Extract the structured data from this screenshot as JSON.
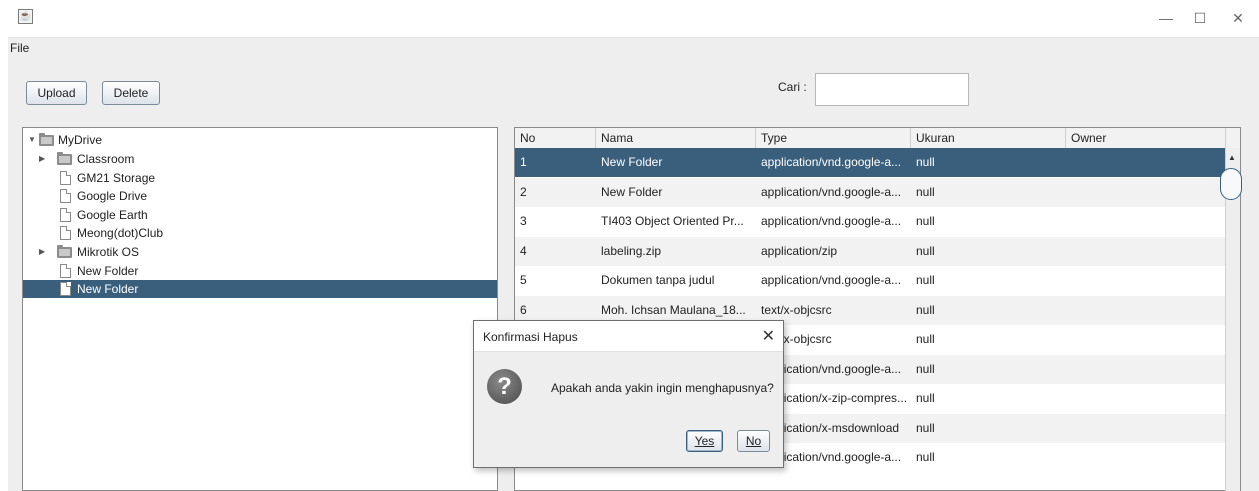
{
  "window": {
    "icon": "java-cup-icon",
    "controls": {
      "minimize": "—",
      "maximize": "☐",
      "close": "✕"
    }
  },
  "menu": {
    "file": "File"
  },
  "toolbar": {
    "upload": "Upload",
    "delete": "Delete",
    "search_label": "Cari :",
    "search_value": ""
  },
  "tree": {
    "root": "MyDrive",
    "items": [
      {
        "label": "Classroom",
        "kind": "folder"
      },
      {
        "label": "GM21 Storage",
        "kind": "file"
      },
      {
        "label": "Google Drive",
        "kind": "file"
      },
      {
        "label": "Google Earth",
        "kind": "file"
      },
      {
        "label": "Meong(dot)Club",
        "kind": "file"
      },
      {
        "label": "Mikrotik OS",
        "kind": "folder"
      },
      {
        "label": "New Folder",
        "kind": "file"
      },
      {
        "label": "New Folder",
        "kind": "file",
        "selected": true
      }
    ]
  },
  "table": {
    "columns": [
      "No",
      "Nama",
      "Type",
      "Ukuran",
      "Owner"
    ],
    "rows": [
      {
        "no": "1",
        "nama": "New Folder",
        "type": "application/vnd.google-a...",
        "ukuran": "null",
        "owner": ""
      },
      {
        "no": "2",
        "nama": "New Folder",
        "type": "application/vnd.google-a...",
        "ukuran": "null",
        "owner": ""
      },
      {
        "no": "3",
        "nama": "TI403 Object Oriented Pr...",
        "type": "application/vnd.google-a...",
        "ukuran": "null",
        "owner": ""
      },
      {
        "no": "4",
        "nama": "labeling.zip",
        "type": "application/zip",
        "ukuran": "null",
        "owner": ""
      },
      {
        "no": "5",
        "nama": "Dokumen tanpa judul",
        "type": "application/vnd.google-a...",
        "ukuran": "null",
        "owner": ""
      },
      {
        "no": "6",
        "nama": "Moh. Ichsan Maulana_18...",
        "type": "text/x-objcsrc",
        "ukuran": "null",
        "owner": ""
      },
      {
        "no": "",
        "nama": "",
        "type": "text/x-objcsrc",
        "ukuran": "null",
        "owner": ""
      },
      {
        "no": "",
        "nama": "",
        "type": "application/vnd.google-a...",
        "ukuran": "null",
        "owner": ""
      },
      {
        "no": "",
        "nama": "",
        "type": "application/x-zip-compres...",
        "ukuran": "null",
        "owner": ""
      },
      {
        "no": "",
        "nama": "",
        "type": "application/x-msdownload",
        "ukuran": "null",
        "owner": ""
      },
      {
        "no": "",
        "nama": "",
        "type": "application/vnd.google-a...",
        "ukuran": "null",
        "owner": ""
      }
    ],
    "selected_row": 0
  },
  "dialog": {
    "title": "Konfirmasi Hapus",
    "message": "Apakah anda yakin ingin menghapusnya?",
    "icon": "question-icon",
    "yes": "Yes",
    "no": "No"
  },
  "colors": {
    "selection": "#3a5f7d",
    "alt_row": "#f2f2f2"
  }
}
